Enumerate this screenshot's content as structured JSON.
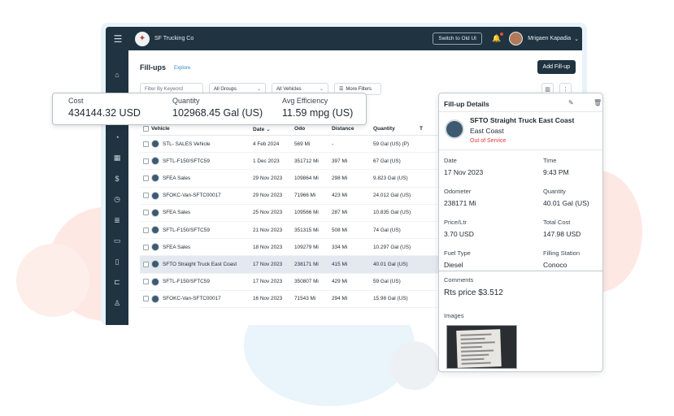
{
  "topbar": {
    "menu_icon": "hamburger-icon",
    "company_name": "SF Trucking Co",
    "switch_label": "Switch to Old UI",
    "user_name": "Mrigaen Kapadia"
  },
  "sidebar": {
    "icons": [
      "home-icon",
      "truck-icon",
      "clipboard-icon",
      "gauge-icon",
      "calendar-icon",
      "dollar-icon",
      "clock-icon",
      "database-icon",
      "tag-icon",
      "document-icon",
      "van-icon",
      "person-icon"
    ]
  },
  "page": {
    "title": "Fill-ups",
    "explore_label": "Explore",
    "add_label": "Add Fill-up"
  },
  "filters": {
    "keyword_placeholder": "Filter By Keyword",
    "groups_label": "All Groups",
    "vehicles_label": "All Vehicles",
    "more_label": "More Filters"
  },
  "stats": {
    "cost_label": "Cost",
    "cost_value": "434144.32 USD",
    "quantity_label": "Quantity",
    "quantity_value": "102968.45 Gal (US)",
    "efficiency_label": "Avg Efficiency",
    "efficiency_value": "11.59 mpg (US)"
  },
  "table": {
    "headers": {
      "vehicle": "Vehicle",
      "date": "Date",
      "odo": "Odo",
      "distance": "Distance",
      "quantity": "Quantity",
      "extra": "T"
    },
    "rows": [
      {
        "vehicle": "STL- SALES Vehicle",
        "date": "4 Feb 2024",
        "odo": "569 Mi",
        "distance": "-",
        "quantity": "59 Gal (US) (P)"
      },
      {
        "vehicle": "SFTL-F150/SFTC59",
        "date": "1 Dec 2023",
        "odo": "351712 Mi",
        "distance": "397 Mi",
        "quantity": "67 Gal (US)"
      },
      {
        "vehicle": "SFEA Sales",
        "date": "29 Nov 2023",
        "odo": "109864 Mi",
        "distance": "298 Mi",
        "quantity": "9.823 Gal (US)"
      },
      {
        "vehicle": "SFOKC-Van-SFTC00017",
        "date": "29 Nov 2023",
        "odo": "71966 Mi",
        "distance": "423 Mi",
        "quantity": "24.012 Gal (US)"
      },
      {
        "vehicle": "SFEA Sales",
        "date": "25 Nov 2023",
        "odo": "109566 Mi",
        "distance": "287 Mi",
        "quantity": "10.835 Gal (US)"
      },
      {
        "vehicle": "SFTL-F150/SFTC59",
        "date": "21 Nov 2023",
        "odo": "351315 Mi",
        "distance": "508 Mi",
        "quantity": "74 Gal (US)"
      },
      {
        "vehicle": "SFEA Sales",
        "date": "18 Nov 2023",
        "odo": "109279 Mi",
        "distance": "334 Mi",
        "quantity": "10.297 Gal (US)"
      },
      {
        "vehicle": "SFTO Straight Truck East Coast",
        "date": "17 Nov 2023",
        "odo": "238171 Mi",
        "distance": "415 Mi",
        "quantity": "40.01 Gal (US)"
      },
      {
        "vehicle": "SFTL-F150/SFTC59",
        "date": "17 Nov 2023",
        "odo": "350807 Mi",
        "distance": "429 Mi",
        "quantity": "59 Gal (US)"
      },
      {
        "vehicle": "SFOKC-Van-SFTC00017",
        "date": "16 Nov 2023",
        "odo": "71543 Mi",
        "distance": "294 Mi",
        "quantity": "15.98 Gal (US)"
      }
    ]
  },
  "details": {
    "title": "Fill-up Details",
    "vehicle_name": "SFTO Straight Truck East Coast",
    "vehicle_group": "East Coast",
    "vehicle_status": "Out of Service",
    "date_label": "Date",
    "date_value": "17 Nov 2023",
    "time_label": "Time",
    "time_value": "9:43 PM",
    "odometer_label": "Odometer",
    "odometer_value": "238171 Mi",
    "quantity_label": "Quantity",
    "quantity_value": "40.01 Gal (US)",
    "price_label": "Price/Ltr",
    "price_value": "3.70 USD",
    "total_label": "Total Cost",
    "total_value": "147.98 USD",
    "fuel_label": "Fuel Type",
    "fuel_value": "Diesel",
    "station_label": "Filling Station",
    "station_value": "Conoco",
    "comments_label": "Comments",
    "comments_value": "Rts price $3.512",
    "images_label": "Images"
  },
  "colors": {
    "nav_dark": "#1f3340",
    "accent_link": "#3a86c8",
    "status_red": "#e53935",
    "selected_row": "#e4e9f0"
  }
}
